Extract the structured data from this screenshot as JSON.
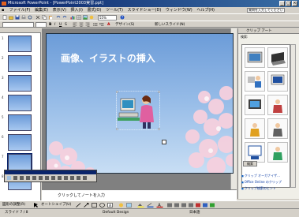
{
  "window": {
    "title": "Microsoft PowerPoint - [PowerPoint2003実習.ppt]",
    "minimize": "_",
    "maximize": "□",
    "close": "×"
  },
  "menu": {
    "items": [
      "ファイル(F)",
      "編集(E)",
      "表示(V)",
      "挿入(I)",
      "書式(O)",
      "ツール(T)",
      "スライドショー(D)",
      "ウィンドウ(W)",
      "ヘルプ(H)"
    ],
    "help_placeholder": "質問を入力してください"
  },
  "toolbar": {
    "zoom": "55%",
    "design_label": "デザイン(S)",
    "new_slide_label": "新しいスライド(N)"
  },
  "slide": {
    "title": "画像、イラストの挿入"
  },
  "slide_numbers": [
    "1",
    "2",
    "3",
    "4",
    "5",
    "6",
    "7",
    "8"
  ],
  "notes": {
    "placeholder": "クリックしてノートを入力"
  },
  "taskpane": {
    "header": "クリップ アート",
    "search_label": "検索:",
    "ok_button": "検索",
    "links": [
      "クリップ オーガナイザ...",
      "Office Online のクリップ",
      "クリップ検索のヒント"
    ]
  },
  "status": {
    "slide_info": "スライド 7 / 8",
    "design": "Default Design",
    "language": "日本語"
  },
  "drawing": {
    "draw_label": "図形の調整(R)",
    "autoshapes_label": "オートシェイプ(U)"
  },
  "colors": {
    "titlebar": "#0a246a",
    "slide_bg_top": "#6c9cd8",
    "slide_bg_bottom": "#c8def4",
    "blossom": "#f4c8d8"
  }
}
